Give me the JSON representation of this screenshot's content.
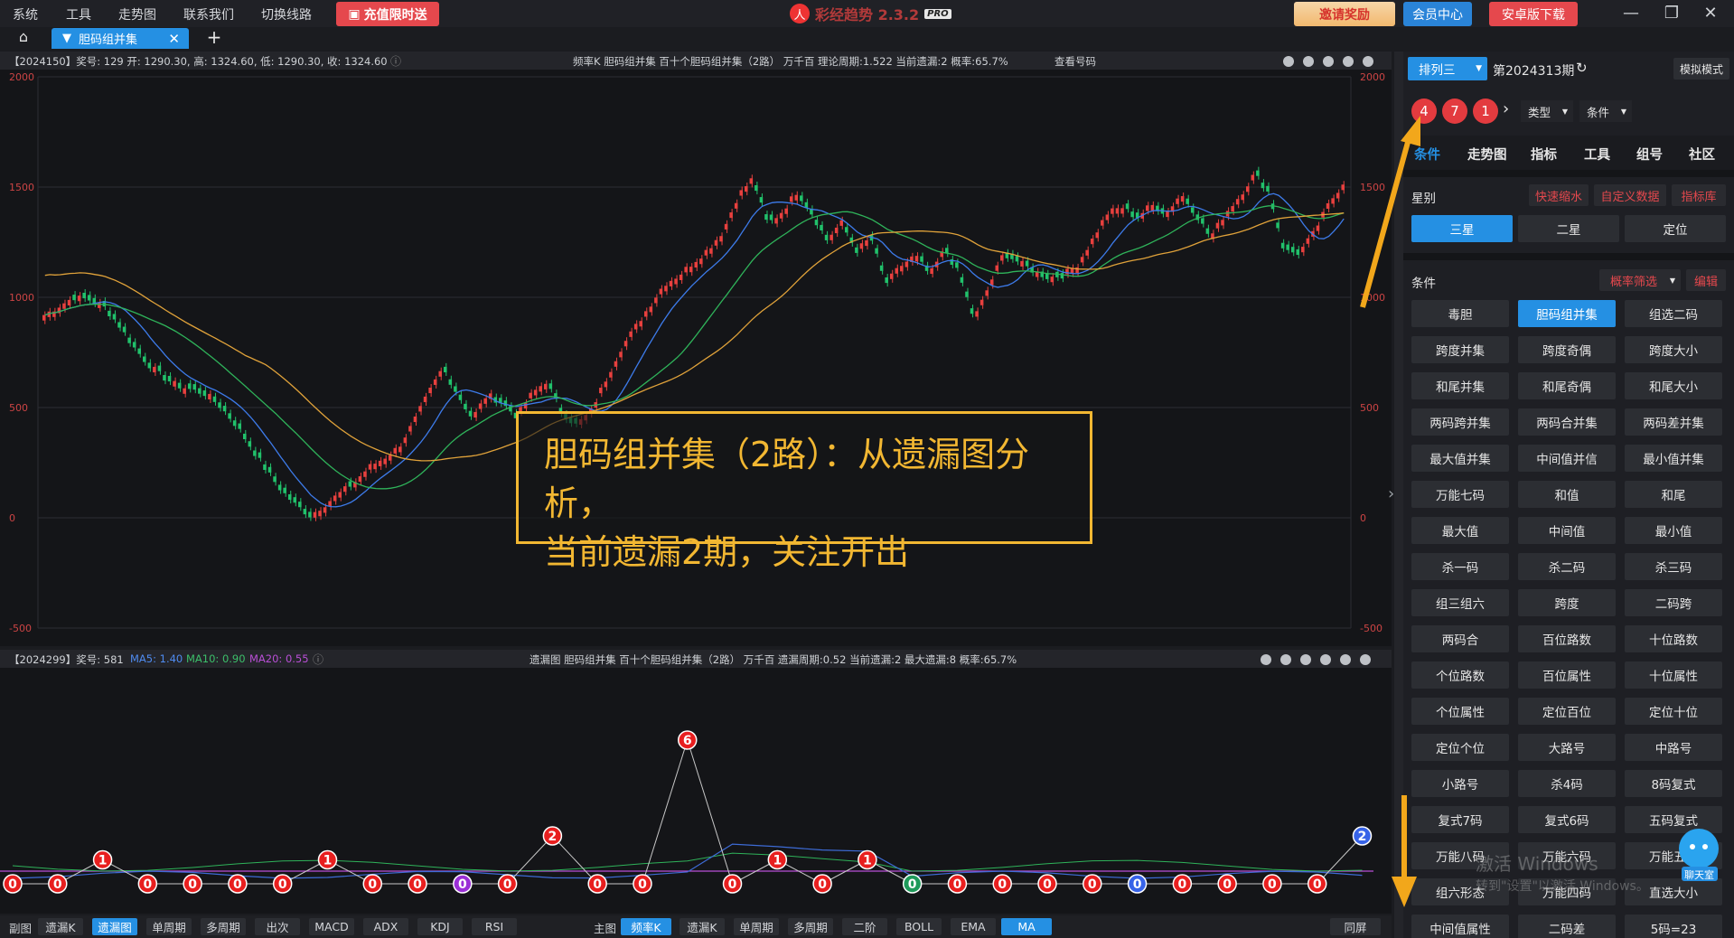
{
  "menubar": {
    "items": [
      "系统",
      "工具",
      "走势图",
      "联系我们",
      "切换线路"
    ],
    "promo": "充值限时送",
    "app_name": "彩经趋势 2.3.2",
    "pro_badge": "PRO",
    "invite": "邀请奖励",
    "member": "会员中心",
    "android": "安卓版下载"
  },
  "tabs": {
    "active": "胆码组并集"
  },
  "chart1": {
    "info": "【2024150】奖号: 129  开: 1290.30, 高: 1324.60, 低: 1290.30, 收: 1324.60",
    "center": "频率K  胆码组并集  百十个胆码组并集（2路）  万千百  理论周期:1.522  当前遗漏:2  概率:65.7%",
    "lookup": "查看号码",
    "y_ticks": [
      "2000",
      "1500",
      "1000",
      "500",
      "0",
      "-500"
    ]
  },
  "chart2": {
    "info_prefix": "【2024299】奖号: 581",
    "ma5": "MA5: 1.40",
    "ma10": "MA10: 0.90",
    "ma20": "MA20: 0.55",
    "center": "遗漏图  胆码组并集  百十个胆码组并集（2路）  万千百  遗漏周期:0.52  当前遗漏:2  最大遗漏:8  概率:65.7%"
  },
  "callout": {
    "line1": "胆码组并集（2路）：从遗漏图分析，",
    "line2": "当前遗漏2期，关注开出"
  },
  "bottom_bar": {
    "sub_label": "副图",
    "sub_buttons": [
      "遗漏K",
      "遗漏图",
      "单周期",
      "多周期",
      "出次",
      "MACD",
      "ADX",
      "KDJ",
      "RSI"
    ],
    "main_label": "主图",
    "main_buttons": [
      "频率K",
      "遗漏K",
      "单周期",
      "多周期",
      "二阶",
      "BOLL",
      "EMA",
      "MA"
    ],
    "same_screen": "同屏"
  },
  "right_panel": {
    "lottery": "排列三",
    "issue": "第2024313期",
    "mode": "模拟模式",
    "balls": [
      "4",
      "7",
      "1"
    ],
    "type_select": "类型",
    "cond_select": "条件",
    "tabs": [
      "条件",
      "走势图",
      "指标",
      "工具",
      "组号",
      "社区"
    ],
    "star_label": "星别",
    "star_links": [
      "快速缩水",
      "自定义数据",
      "指标库"
    ],
    "star_buttons": [
      "三星",
      "二星",
      "定位"
    ],
    "cond_label": "条件",
    "prob_filter": "概率筛选",
    "edit": "编辑",
    "conditions": [
      "毒胆",
      "胆码组并集",
      "组选二码",
      "跨度并集",
      "跨度奇偶",
      "跨度大小",
      "和尾并集",
      "和尾奇偶",
      "和尾大小",
      "两码跨并集",
      "两码合并集",
      "两码差并集",
      "最大值并集",
      "中间值并信",
      "最小值并集",
      "万能七码",
      "和值",
      "和尾",
      "最大值",
      "中间值",
      "最小值",
      "杀一码",
      "杀二码",
      "杀三码",
      "组三组六",
      "跨度",
      "二码跨",
      "两码合",
      "百位路数",
      "十位路数",
      "个位路数",
      "百位属性",
      "十位属性",
      "个位属性",
      "定位百位",
      "定位十位",
      "定位个位",
      "大路号",
      "中路号",
      "小路号",
      "杀4码",
      "8码复式",
      "复式7码",
      "复式6码",
      "五码复式",
      "万能八码",
      "万能六码",
      "万能五码",
      "组六形态",
      "万能四码",
      "直选大小",
      "中间值属性",
      "二码差",
      "5码=23"
    ],
    "watermark1": "激活 Windows",
    "watermark2": "转到\"设置\"以激活 Windows。",
    "chat": "聊天室"
  },
  "chart_data": [
    {
      "type": "candlestick",
      "title": "",
      "ylim": [
        -500,
        2000
      ],
      "y_ticks": [
        2000,
        1500,
        1000,
        500,
        0,
        -500
      ],
      "close_profile": [
        920,
        960,
        1000,
        990,
        960,
        880,
        780,
        700,
        640,
        600,
        580,
        560,
        500,
        420,
        320,
        220,
        130,
        60,
        10,
        60,
        110,
        160,
        230,
        270,
        320,
        430,
        560,
        680,
        560,
        450,
        560,
        520,
        460,
        560,
        620,
        480,
        420,
        480,
        620,
        760,
        860,
        960,
        1060,
        1100,
        1160,
        1220,
        1300,
        1460,
        1540,
        1330,
        1390,
        1480,
        1380,
        1260,
        1340,
        1210,
        1270,
        1060,
        1140,
        1190,
        1100,
        1220,
        1100,
        900,
        1050,
        1200,
        1160,
        1120,
        1090,
        1100,
        1150,
        1260,
        1380,
        1410,
        1360,
        1420,
        1380,
        1470,
        1380,
        1270,
        1380,
        1460,
        1560,
        1470,
        1210,
        1200,
        1290,
        1420,
        1520
      ],
      "ma_series": [
        "blue",
        "green",
        "orange"
      ]
    },
    {
      "type": "line",
      "title": "",
      "series_miss": [
        0,
        0,
        1,
        0,
        0,
        0,
        0,
        1,
        0,
        0,
        0,
        0,
        2,
        0,
        0,
        6,
        0,
        1,
        0,
        1,
        0,
        0,
        0,
        0,
        0,
        0,
        0,
        0,
        0,
        0,
        2
      ],
      "series_colors": [
        "red",
        "red",
        "red",
        "red",
        "red",
        "red",
        "red",
        "red",
        "red",
        "red",
        "purple",
        "red",
        "red",
        "red",
        "red",
        "red",
        "red",
        "red",
        "red",
        "red",
        "green",
        "red",
        "red",
        "red",
        "red",
        "blue",
        "red",
        "red",
        "red",
        "red",
        "blue"
      ]
    }
  ]
}
